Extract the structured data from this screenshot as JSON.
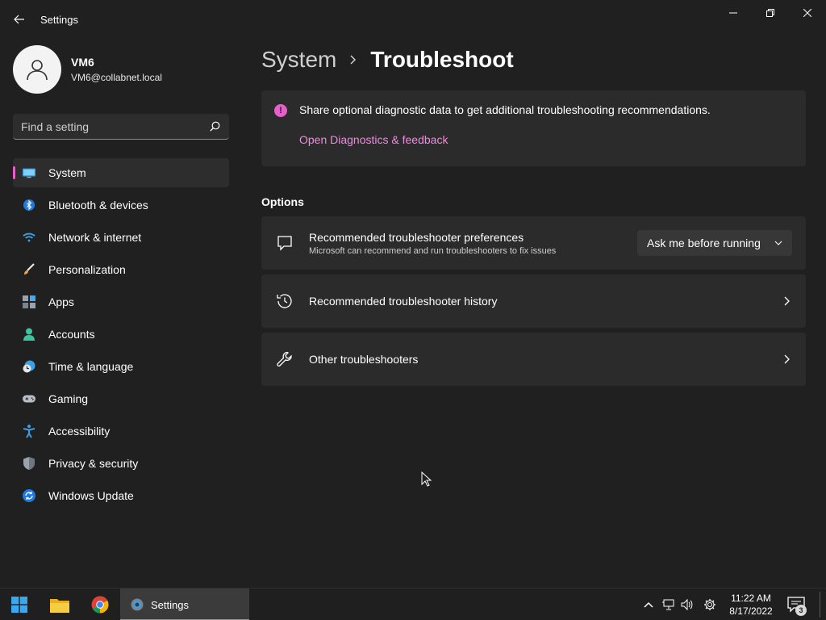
{
  "window": {
    "title": "Settings"
  },
  "profile": {
    "name": "VM6",
    "email": "VM6@collabnet.local"
  },
  "search": {
    "placeholder": "Find a setting"
  },
  "sidebar": {
    "items": [
      {
        "label": "System",
        "icon": "system-icon",
        "active": true
      },
      {
        "label": "Bluetooth & devices",
        "icon": "bluetooth-icon"
      },
      {
        "label": "Network & internet",
        "icon": "wifi-icon"
      },
      {
        "label": "Personalization",
        "icon": "brush-icon"
      },
      {
        "label": "Apps",
        "icon": "apps-icon"
      },
      {
        "label": "Accounts",
        "icon": "person-icon"
      },
      {
        "label": "Time & language",
        "icon": "clock-globe-icon"
      },
      {
        "label": "Gaming",
        "icon": "gamepad-icon"
      },
      {
        "label": "Accessibility",
        "icon": "accessibility-icon"
      },
      {
        "label": "Privacy & security",
        "icon": "shield-icon"
      },
      {
        "label": "Windows Update",
        "icon": "update-icon"
      }
    ]
  },
  "breadcrumb": {
    "parent": "System",
    "current": "Troubleshoot"
  },
  "diagnostics": {
    "message": "Share optional diagnostic data to get additional troubleshooting recommendations.",
    "link": "Open Diagnostics & feedback"
  },
  "options": {
    "section_title": "Options",
    "preferences": {
      "title": "Recommended troubleshooter preferences",
      "subtitle": "Microsoft can recommend and run troubleshooters to fix issues",
      "dropdown_value": "Ask me before running"
    },
    "history": {
      "title": "Recommended troubleshooter history"
    },
    "other": {
      "title": "Other troubleshooters"
    }
  },
  "taskbar": {
    "settings_label": "Settings",
    "time": "11:22 AM",
    "date": "8/17/2022",
    "notification_count": "3"
  },
  "colors": {
    "accent": "#e85fcc",
    "link": "#f08be0",
    "background": "#202020",
    "card": "#2b2b2b"
  }
}
